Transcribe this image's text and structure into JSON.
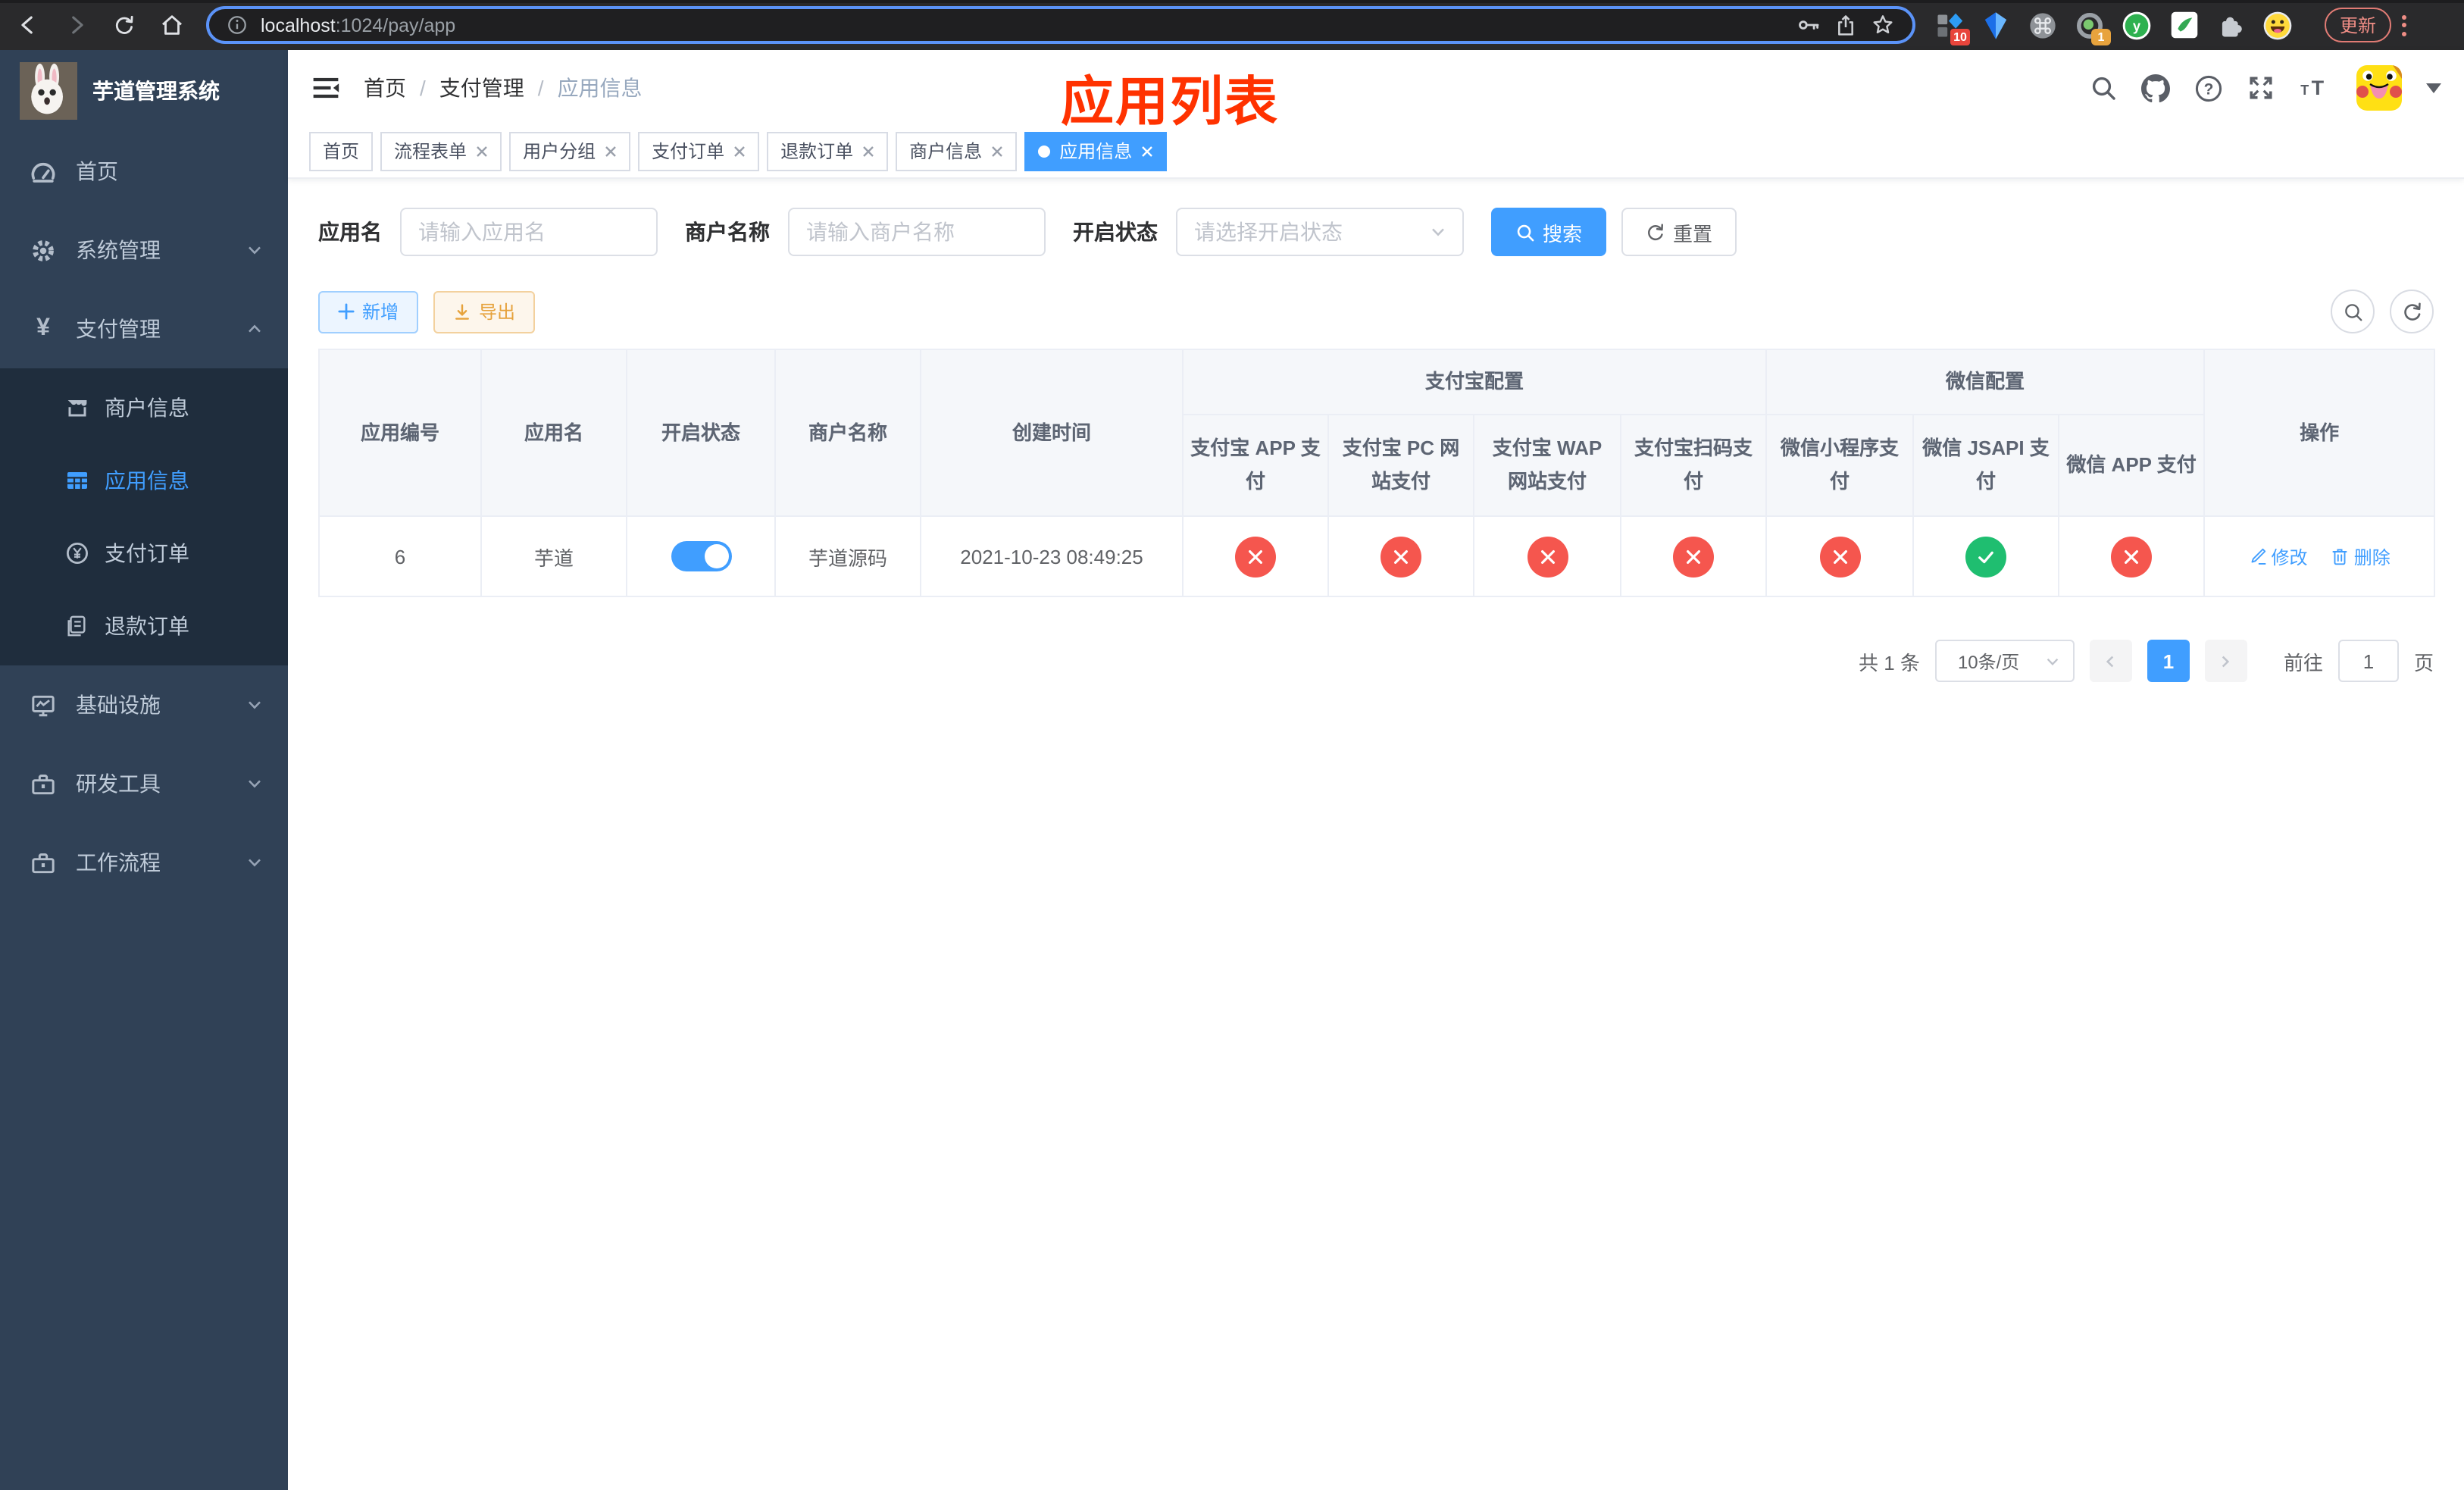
{
  "colors": {
    "accent": "#409eff",
    "success": "#1fbe70",
    "danger": "#f5564e",
    "warning": "#e6a23c",
    "annotation": "#ff3200",
    "sidebar_bg": "#304156",
    "submenu_bg": "#1f2d3d"
  },
  "browser": {
    "url_host": "localhost",
    "url_rest": ":1024/pay/app",
    "update_button": "更新",
    "ext_badge_1": "10",
    "ext_badge_2": "1"
  },
  "sidebar": {
    "app_title": "芋道管理系统",
    "items": [
      {
        "label": "首页",
        "icon": "dashboard-icon",
        "chevron": "none",
        "active": false
      },
      {
        "label": "系统管理",
        "icon": "gear-icon",
        "chevron": "down",
        "active": false
      },
      {
        "label": "支付管理",
        "icon": "yen-icon",
        "chevron": "up",
        "active": true
      },
      {
        "label": "基础设施",
        "icon": "monitor-icon",
        "chevron": "down",
        "active": false
      },
      {
        "label": "研发工具",
        "icon": "toolbox-icon",
        "chevron": "down",
        "active": false
      },
      {
        "label": "工作流程",
        "icon": "toolbox-icon",
        "chevron": "down",
        "active": false
      }
    ],
    "submenu": [
      {
        "label": "商户信息",
        "icon": "shop-icon",
        "active": false
      },
      {
        "label": "应用信息",
        "icon": "grid-icon",
        "active": true
      },
      {
        "label": "支付订单",
        "icon": "yen-circle-icon",
        "active": false
      },
      {
        "label": "退款订单",
        "icon": "document-icon",
        "active": false
      }
    ]
  },
  "navbar": {
    "breadcrumb": [
      "首页",
      "支付管理",
      "应用信息"
    ],
    "breadcrumb_separator": "/",
    "annotation": "应用列表"
  },
  "tabs": [
    {
      "label": "首页",
      "closable": false,
      "active": false
    },
    {
      "label": "流程表单",
      "closable": true,
      "active": false
    },
    {
      "label": "用户分组",
      "closable": true,
      "active": false
    },
    {
      "label": "支付订单",
      "closable": true,
      "active": false
    },
    {
      "label": "退款订单",
      "closable": true,
      "active": false
    },
    {
      "label": "商户信息",
      "closable": true,
      "active": false
    },
    {
      "label": "应用信息",
      "closable": true,
      "active": true
    }
  ],
  "filters": {
    "app_name_label": "应用名",
    "app_name_placeholder": "请输入应用名",
    "merchant_label": "商户名称",
    "merchant_placeholder": "请输入商户名称",
    "status_label": "开启状态",
    "status_placeholder": "请选择开启状态",
    "search_button": "搜索",
    "reset_button": "重置"
  },
  "toolbar": {
    "add_button": "新增",
    "export_button": "导出"
  },
  "table": {
    "main_columns": [
      "应用编号",
      "应用名",
      "开启状态",
      "商户名称",
      "创建时间"
    ],
    "alipay_group": {
      "label": "支付宝配置",
      "columns": [
        "支付宝 APP 支付",
        "支付宝 PC 网站支付",
        "支付宝 WAP 网站支付",
        "支付宝扫码支付"
      ]
    },
    "wechat_group": {
      "label": "微信配置",
      "columns": [
        "微信小程序支付",
        "微信 JSAPI 支付",
        "微信 APP 支付"
      ]
    },
    "action_column": "操作",
    "rows": [
      {
        "id": "6",
        "name": "芋道",
        "enabled": true,
        "merchant": "芋道源码",
        "created_at": "2021-10-23 08:49:25",
        "channel_status": [
          false,
          false,
          false,
          false,
          false,
          true,
          false
        ],
        "actions": {
          "edit": "修改",
          "delete": "删除"
        }
      }
    ]
  },
  "pagination": {
    "total_text": "共 1 条",
    "page_size": "10条/页",
    "current_page": "1",
    "goto_label": "前往",
    "goto_value": "1",
    "page_suffix": "页"
  }
}
